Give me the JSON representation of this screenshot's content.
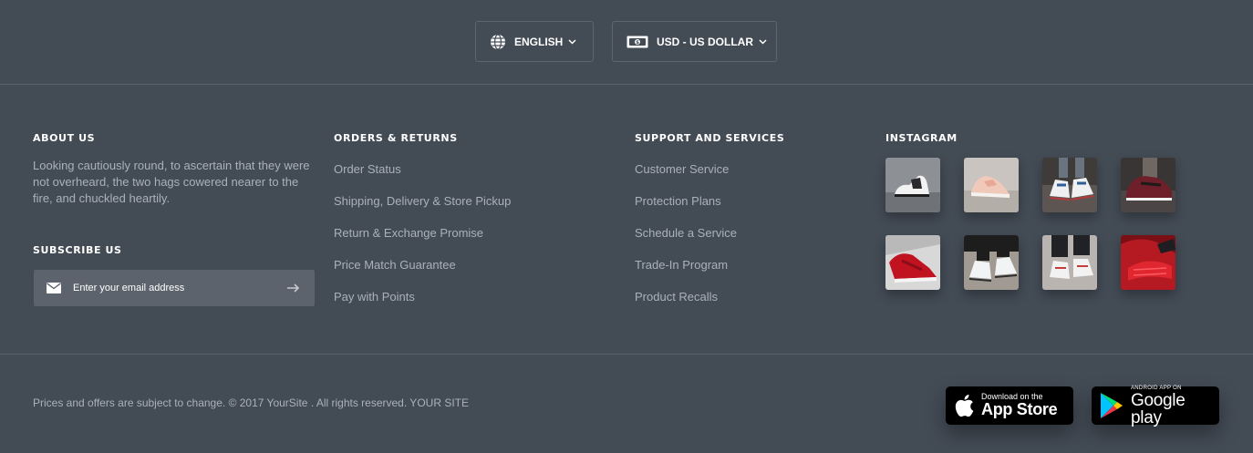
{
  "top_bar": {
    "language": {
      "label": "ENGLISH",
      "icon": "globe-icon"
    },
    "currency": {
      "label": "USD - US DOLLAR",
      "icon": "banknote-icon"
    }
  },
  "about": {
    "title": "ABOUT US",
    "text": "Looking cautiously round, to ascertain that they were not overheard, the two hags cowered nearer to the fire, and chuckled heartily."
  },
  "subscribe": {
    "title": "SUBSCRIBE US",
    "placeholder": "Enter your email address",
    "value": ""
  },
  "orders": {
    "title": "ORDERS & RETURNS",
    "items": [
      "Order Status",
      "Shipping, Delivery & Store Pickup",
      "Return & Exchange Promise",
      "Price Match Guarantee",
      "Pay with Points"
    ]
  },
  "support": {
    "title": "SUPPORT AND SERVICES",
    "items": [
      "Customer Service",
      "Protection Plans",
      "Schedule a Service",
      "Trade-In Program",
      "Product Recalls"
    ]
  },
  "instagram": {
    "title": "INSTAGRAM",
    "photos": [
      "sneakers-white-black",
      "sneakers-pink",
      "sneakers-white-blue",
      "sneakers-burgundy",
      "sneakers-red",
      "sneakers-white-on-feet",
      "sneakers-white-jeans",
      "sneakers-red-sole"
    ]
  },
  "footer": {
    "copyright": "Prices and offers are subject to change. © 2017 YourSite . All rights reserved. YOUR SITE",
    "app_store": {
      "small": "Download on the",
      "big": "App Store"
    },
    "google_play": {
      "small": "ANDROID APP ON",
      "big": "Google play"
    }
  },
  "colors": {
    "background": "#434b55",
    "input_bg": "#5c636d",
    "divider": "#5a626c",
    "text_muted": "#aab1ba"
  }
}
